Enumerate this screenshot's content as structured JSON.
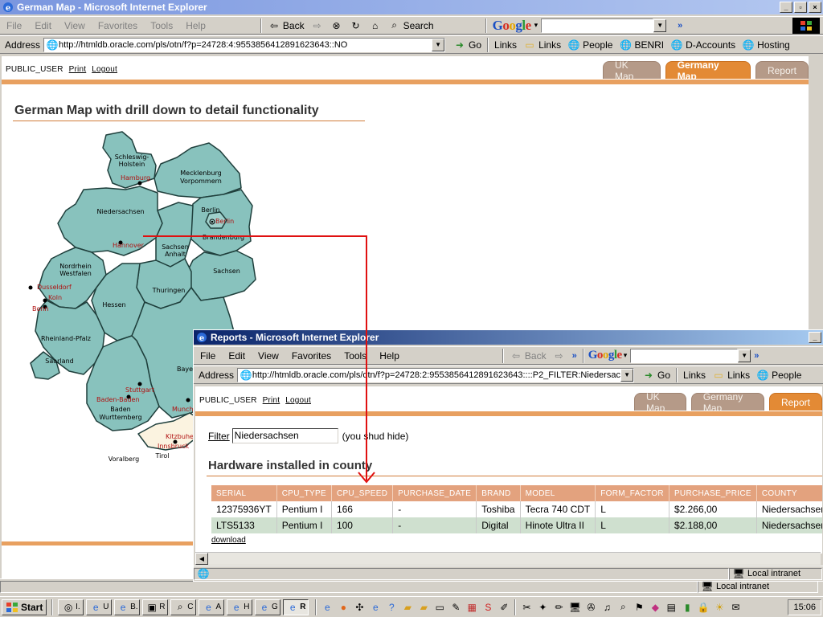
{
  "main_window": {
    "title": "German Map - Microsoft Internet Explorer",
    "menu": [
      "File",
      "Edit",
      "View",
      "Favorites",
      "Tools",
      "Help"
    ],
    "toolbar": {
      "back": "Back",
      "search": "Search"
    },
    "google_logo": "Google",
    "address_label": "Address",
    "url": "http://htmldb.oracle.com/pls/otn/f?p=24728:4:9553856412891623643::NO",
    "go": "Go",
    "links_label": "Links",
    "links": [
      "Links",
      "People",
      "BENRI",
      "D-Accounts",
      "Hosting"
    ]
  },
  "main_page": {
    "user": "PUBLIC_USER",
    "print": "Print",
    "logout": "Logout",
    "tabs": [
      "UK Map",
      "Germany Map",
      "Report"
    ],
    "heading": "German Map with drill down to detail functionality"
  },
  "map": {
    "regions": [
      "Schleswig-\nHolstein",
      "Mecklenburg\nVorpommern",
      "Niedersachsen",
      "Berlin",
      "Brandenburg",
      "Sachsen\nAnhalt",
      "Nordrhein\nWestfalen",
      "Sachsen",
      "Thuringen",
      "Hessen",
      "Rheinland-Pfalz",
      "Saarland",
      "Baden\nWurttemberg",
      "Baye",
      "Tirol",
      "Voralberg"
    ],
    "cities": [
      "Hamburg",
      "Berlin",
      "Hannover",
      "Dusseldorf",
      "Koln",
      "Bonn",
      "Stuttgart",
      "Baden-Baden",
      "Munch",
      "Kitzbuhe",
      "Innsbruck"
    ]
  },
  "popup_window": {
    "title": "Reports - Microsoft Internet Explorer",
    "menu": [
      "File",
      "Edit",
      "View",
      "Favorites",
      "Tools",
      "Help"
    ],
    "back": "Back",
    "google_logo": "Google",
    "address_label": "Address",
    "url": "http://htmldb.oracle.com/pls/otn/f?p=24728:2:9553856412891623643::::P2_FILTER:Niedersach",
    "go": "Go",
    "links_label": "Links",
    "links": [
      "Links",
      "People"
    ],
    "status": "Local intranet"
  },
  "popup_page": {
    "user": "PUBLIC_USER",
    "print": "Print",
    "logout": "Logout",
    "tabs": [
      "UK Map",
      "Germany Map",
      "Report"
    ],
    "filter_label": "Filter",
    "filter_value": "Niedersachsen",
    "filter_note": "(you shud hide)",
    "heading": "Hardware installed in county",
    "table": {
      "columns": [
        "SERIAL",
        "CPU_TYPE",
        "CPU_SPEED",
        "PURCHASE_DATE",
        "BRAND",
        "MODEL",
        "FORM_FACTOR",
        "PURCHASE_PRICE",
        "COUNTY"
      ],
      "rows": [
        [
          "12375936YT",
          "Pentium I",
          "166",
          "-",
          "Toshiba",
          "Tecra 740 CDT",
          "L",
          "$2.266,00",
          "Niedersachsen"
        ],
        [
          "LTS5133",
          "Pentium I",
          "100",
          "-",
          "Digital",
          "Hinote Ultra II",
          "L",
          "$2.188,00",
          "Niedersachsen"
        ]
      ]
    },
    "download": "download"
  },
  "main_status": "Local intranet",
  "taskbar": {
    "start": "Start",
    "buttons": [
      "I.",
      "U",
      "B.",
      "R",
      "C",
      "A",
      "H",
      "G",
      "R"
    ],
    "clock": "15:06"
  }
}
